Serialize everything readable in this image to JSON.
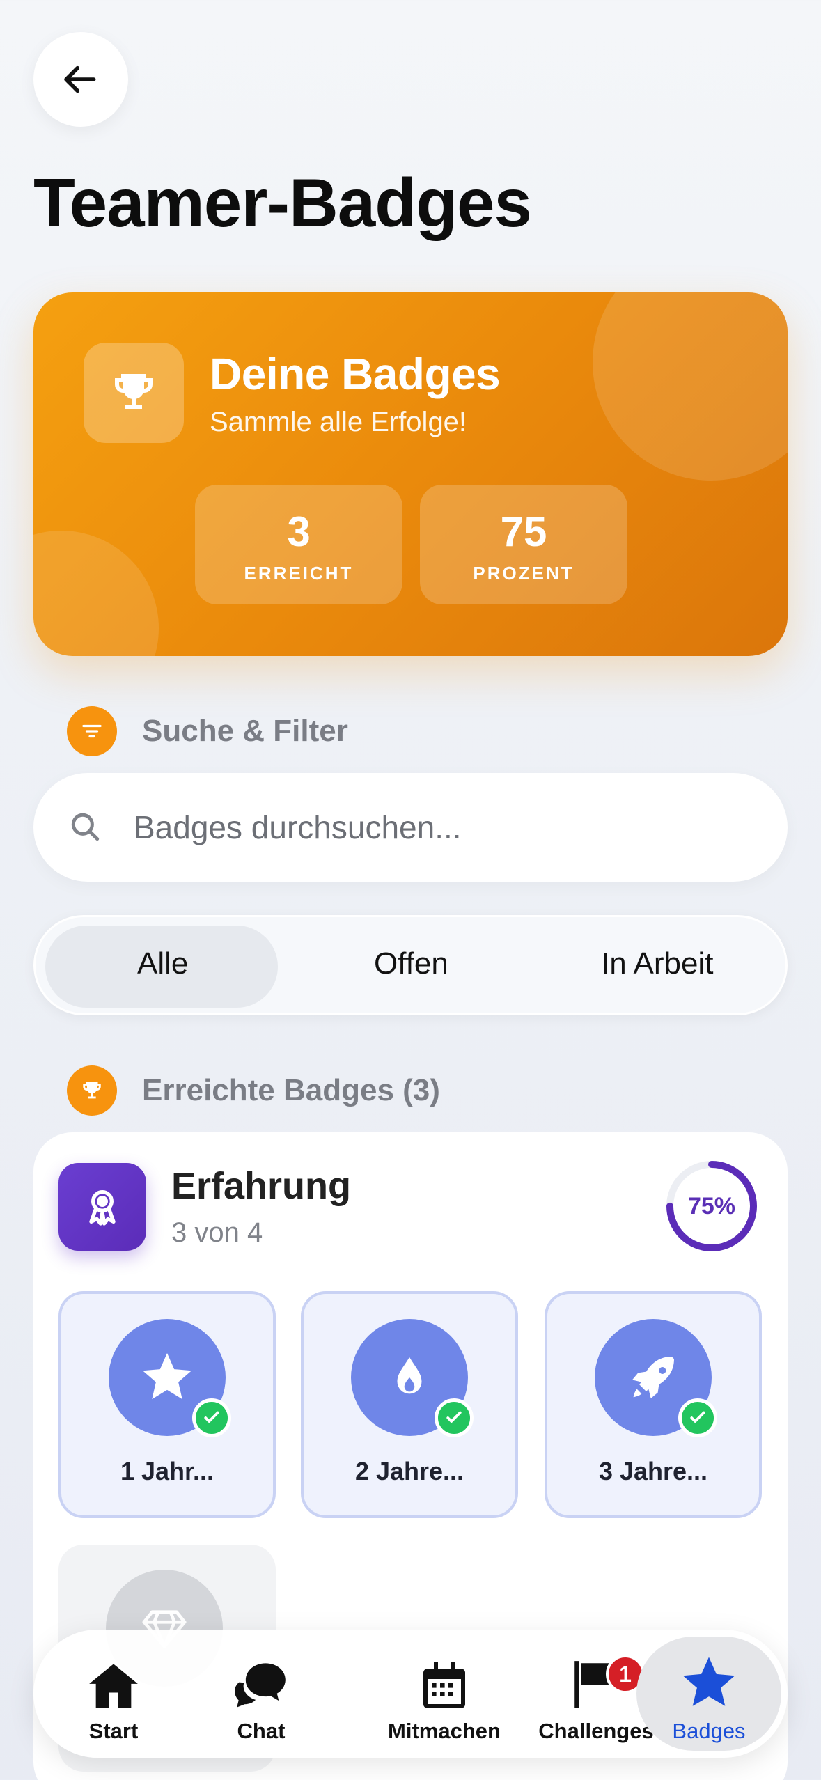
{
  "page": {
    "title": "Teamer-Badges"
  },
  "hero": {
    "title": "Deine Badges",
    "subtitle": "Sammle alle Erfolge!",
    "stats": [
      {
        "value": "3",
        "label": "ERREICHT"
      },
      {
        "value": "75",
        "label": "PROZENT"
      }
    ]
  },
  "filter_section": {
    "title": "Suche & Filter",
    "search_placeholder": "Badges durchsuchen...",
    "segments": [
      "Alle",
      "Offen",
      "In Arbeit"
    ],
    "selected_segment": "Alle"
  },
  "achieved_section": {
    "title": "Erreichte Badges (3)"
  },
  "category": {
    "title": "Erfahrung",
    "subtitle": "3 von 4",
    "progress_label": "75%",
    "progress": 0.75,
    "badges": [
      {
        "name": "1 Jahr...",
        "icon": "star-icon",
        "achieved": true
      },
      {
        "name": "2 Jahre...",
        "icon": "drop-icon",
        "achieved": true
      },
      {
        "name": "3 Jahre...",
        "icon": "rocket-icon",
        "achieved": true
      },
      {
        "name": "",
        "icon": "diamond-icon",
        "achieved": false
      }
    ]
  },
  "tabbar": {
    "items": [
      {
        "label": "Start",
        "icon": "home-icon"
      },
      {
        "label": "Chat",
        "icon": "chat-icon"
      },
      {
        "label": "Mitmachen",
        "icon": "calendar-icon"
      },
      {
        "label": "Challenges",
        "icon": "flag-icon",
        "badge": "1"
      },
      {
        "label": "Badges",
        "icon": "star-icon",
        "active": true
      }
    ]
  },
  "colors": {
    "accent_orange": "#f5a010",
    "accent_purple": "#5b2cb8",
    "badge_blue": "#6f86e8",
    "active_tab": "#1b4fd8",
    "success": "#22c55e"
  }
}
